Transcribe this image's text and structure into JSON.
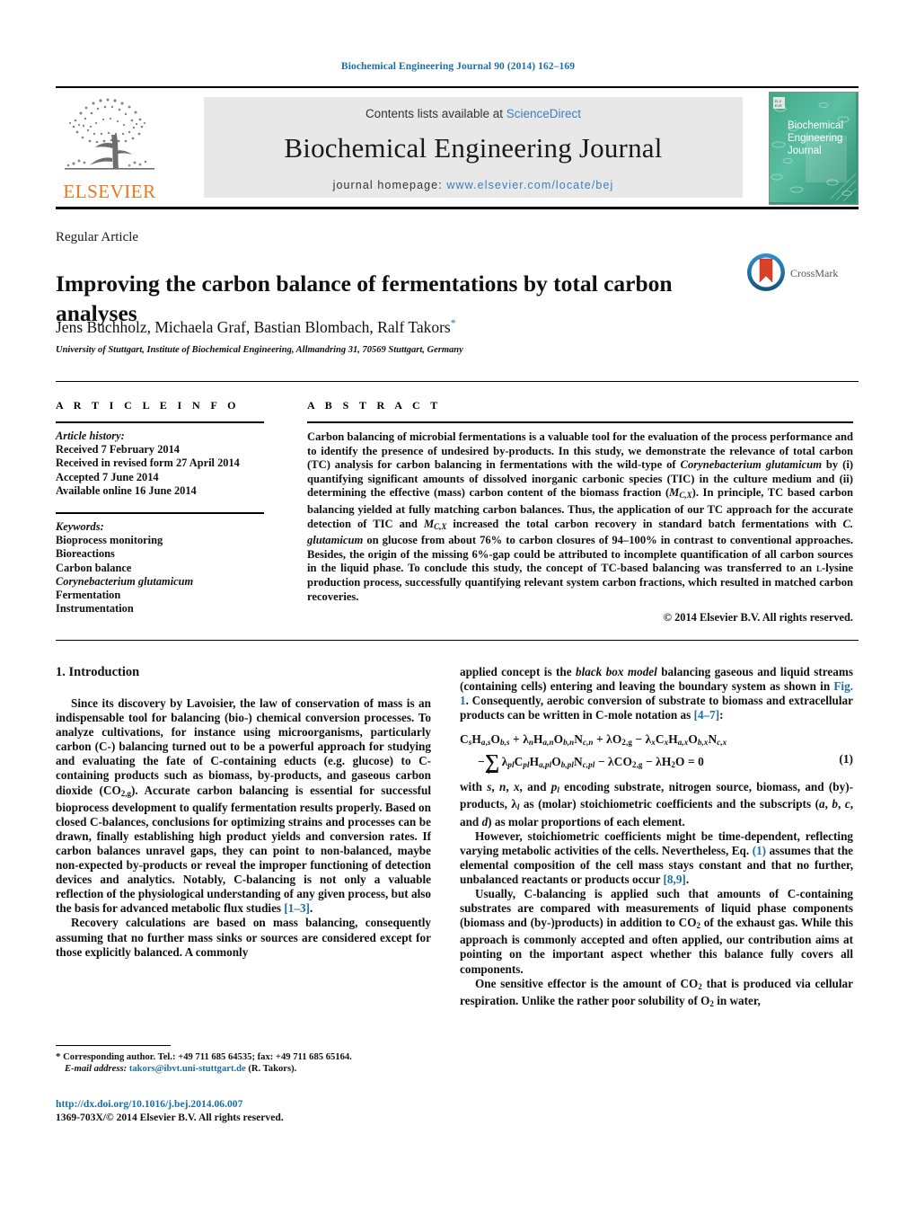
{
  "running_head": "Biochemical Engineering Journal 90 (2014) 162–169",
  "masthead": {
    "publisher_name": "ELSEVIER",
    "contents_prefix": "Contents lists available at ",
    "contents_link": "ScienceDirect",
    "journal_title": "Biochemical Engineering Journal",
    "homepage_prefix": "journal homepage: ",
    "homepage_url": "www.elsevier.com/locate/bej",
    "cover_lines": [
      "Biochemical",
      "Engineering",
      "Journal"
    ],
    "cover_color": "#3aa37e"
  },
  "article": {
    "type": "Regular Article",
    "title": "Improving the carbon balance of fermentations by total carbon analyses",
    "authors": "Jens Buchholz, Michaela Graf, Bastian Blombach, Ralf Takors",
    "author_star": "*",
    "affiliation": "University of Stuttgart, Institute of Biochemical Engineering, Allmandring 31, 70569 Stuttgart, Germany",
    "crossmark_label": "CrossMark"
  },
  "info": {
    "heading": "A R T I C L E    I N F O",
    "history_label": "Article history:",
    "history": [
      "Received 7 February 2014",
      "Received in revised form 27 April 2014",
      "Accepted 7 June 2014",
      "Available online 16 June 2014"
    ],
    "keywords_label": "Keywords:",
    "keywords": [
      "Bioprocess monitoring",
      "Bioreactions",
      "Carbon balance",
      "Corynebacterium glutamicum",
      "Fermentation",
      "Instrumentation"
    ],
    "keyword_italic_index": 3
  },
  "abstract": {
    "heading": "A B S T R A C T",
    "copyright": "© 2014 Elsevier B.V. All rights reserved."
  },
  "intro": {
    "section_number_title": "1.  Introduction"
  },
  "equation": {
    "number": "(1)"
  },
  "footnote": {
    "corresponding": "Corresponding author. Tel.: +49 711 685 64535; fax: +49 711 685 65164.",
    "email_label": "E-mail address:",
    "email": "takors@ibvt.uni-stuttgart.de",
    "email_suffix": "(R. Takors)."
  },
  "footer": {
    "doi": "http://dx.doi.org/10.1016/j.bej.2014.06.007",
    "issn_line": "1369-703X/© 2014 Elsevier B.V. All rights reserved."
  },
  "colors": {
    "link": "#1a6fa8",
    "sciencedirect": "#3b7fbf",
    "elsevier_orange": "#E87722",
    "band_grey": "#e8e8e8"
  }
}
